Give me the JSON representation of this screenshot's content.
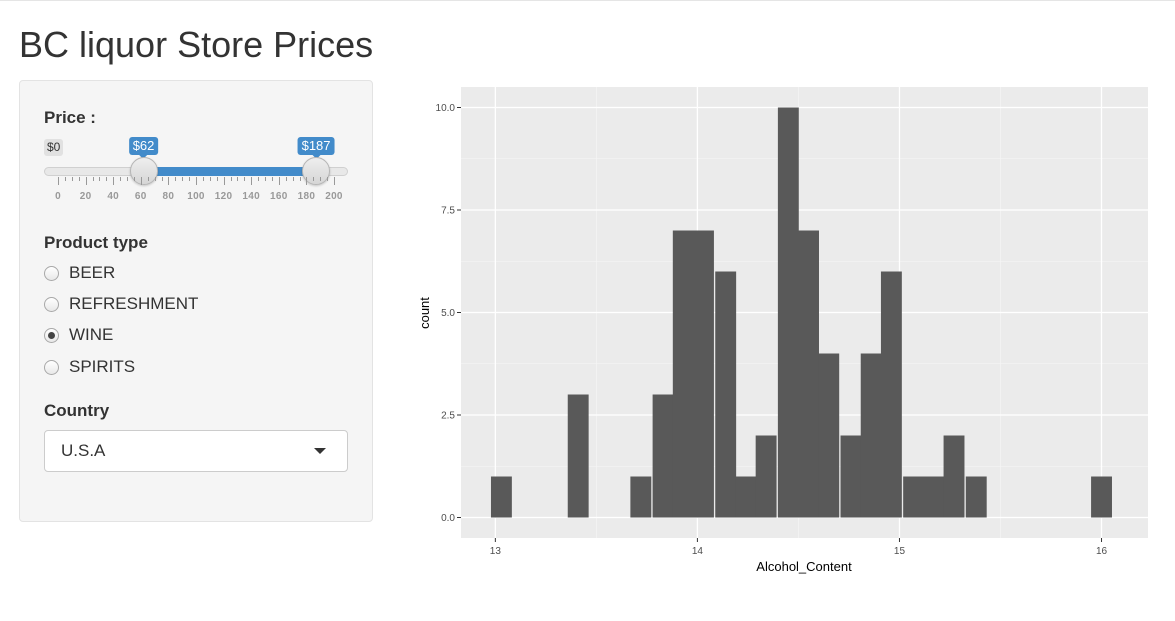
{
  "app": {
    "title": "BC liquor Store Prices"
  },
  "price": {
    "label": "Price :",
    "min_label": "$0",
    "low_label": "$62",
    "high_label": "$187",
    "min": 0,
    "max": 200,
    "low": 62,
    "high": 187,
    "tick_labels": [
      "0",
      "20",
      "40",
      "60",
      "80",
      "100",
      "120",
      "140",
      "160",
      "180",
      "200"
    ]
  },
  "product_type": {
    "label": "Product type",
    "options": [
      {
        "label": "BEER",
        "checked": false
      },
      {
        "label": "REFRESHMENT",
        "checked": false
      },
      {
        "label": "WINE",
        "checked": true
      },
      {
        "label": "SPIRITS",
        "checked": false
      }
    ]
  },
  "country": {
    "label": "Country",
    "value": "U.S.A"
  },
  "colors": {
    "accent": "#428bca",
    "panel_bg": "#ebebeb",
    "bar": "#595959",
    "grid": "#ffffff"
  },
  "chart_data": {
    "type": "bar",
    "xlabel": "Alcohol_Content",
    "ylabel": "count",
    "xlim": [
      12.83,
      16.23
    ],
    "ylim": [
      -0.5,
      10.5
    ],
    "x_ticks": [
      13,
      14,
      15,
      16
    ],
    "x_tick_labels": [
      "13",
      "14",
      "15",
      "16"
    ],
    "y_ticks": [
      0,
      2.5,
      5,
      7.5,
      10
    ],
    "y_tick_labels": [
      "0.0",
      "2.5",
      "5.0",
      "7.5",
      "10.0"
    ],
    "bin_width": 0.1034,
    "bin_centers": [
      13.03,
      13.41,
      13.72,
      13.83,
      13.93,
      14.03,
      14.14,
      14.24,
      14.34,
      14.45,
      14.55,
      14.65,
      14.76,
      14.86,
      14.96,
      15.07,
      15.17,
      15.27,
      15.38,
      16.0
    ],
    "counts": [
      1,
      3,
      1,
      3,
      7,
      7,
      6,
      1,
      2,
      10,
      7,
      4,
      2,
      4,
      6,
      1,
      1,
      2,
      1,
      1
    ],
    "grid": true,
    "legend": "none"
  }
}
